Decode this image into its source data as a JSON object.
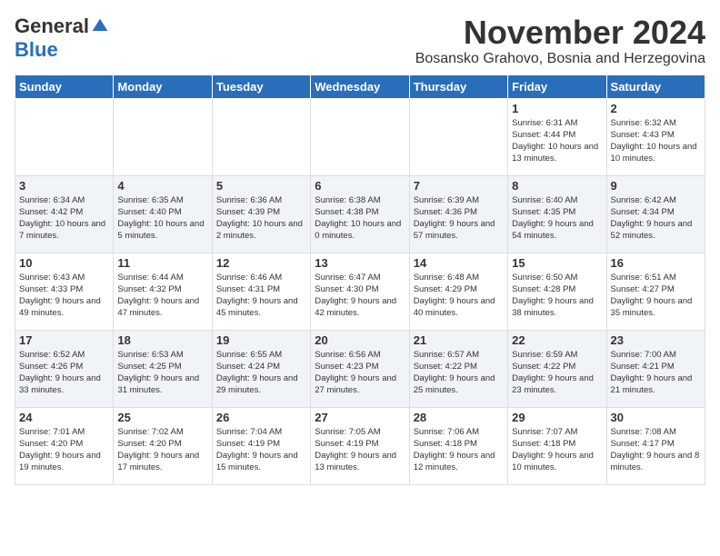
{
  "logo": {
    "general": "General",
    "blue": "Blue"
  },
  "title": "November 2024",
  "subtitle": "Bosansko Grahovo, Bosnia and Herzegovina",
  "weekdays": [
    "Sunday",
    "Monday",
    "Tuesday",
    "Wednesday",
    "Thursday",
    "Friday",
    "Saturday"
  ],
  "weeks": [
    [
      {
        "day": "",
        "info": ""
      },
      {
        "day": "",
        "info": ""
      },
      {
        "day": "",
        "info": ""
      },
      {
        "day": "",
        "info": ""
      },
      {
        "day": "",
        "info": ""
      },
      {
        "day": "1",
        "info": "Sunrise: 6:31 AM\nSunset: 4:44 PM\nDaylight: 10 hours and 13 minutes."
      },
      {
        "day": "2",
        "info": "Sunrise: 6:32 AM\nSunset: 4:43 PM\nDaylight: 10 hours and 10 minutes."
      }
    ],
    [
      {
        "day": "3",
        "info": "Sunrise: 6:34 AM\nSunset: 4:42 PM\nDaylight: 10 hours and 7 minutes."
      },
      {
        "day": "4",
        "info": "Sunrise: 6:35 AM\nSunset: 4:40 PM\nDaylight: 10 hours and 5 minutes."
      },
      {
        "day": "5",
        "info": "Sunrise: 6:36 AM\nSunset: 4:39 PM\nDaylight: 10 hours and 2 minutes."
      },
      {
        "day": "6",
        "info": "Sunrise: 6:38 AM\nSunset: 4:38 PM\nDaylight: 10 hours and 0 minutes."
      },
      {
        "day": "7",
        "info": "Sunrise: 6:39 AM\nSunset: 4:36 PM\nDaylight: 9 hours and 57 minutes."
      },
      {
        "day": "8",
        "info": "Sunrise: 6:40 AM\nSunset: 4:35 PM\nDaylight: 9 hours and 54 minutes."
      },
      {
        "day": "9",
        "info": "Sunrise: 6:42 AM\nSunset: 4:34 PM\nDaylight: 9 hours and 52 minutes."
      }
    ],
    [
      {
        "day": "10",
        "info": "Sunrise: 6:43 AM\nSunset: 4:33 PM\nDaylight: 9 hours and 49 minutes."
      },
      {
        "day": "11",
        "info": "Sunrise: 6:44 AM\nSunset: 4:32 PM\nDaylight: 9 hours and 47 minutes."
      },
      {
        "day": "12",
        "info": "Sunrise: 6:46 AM\nSunset: 4:31 PM\nDaylight: 9 hours and 45 minutes."
      },
      {
        "day": "13",
        "info": "Sunrise: 6:47 AM\nSunset: 4:30 PM\nDaylight: 9 hours and 42 minutes."
      },
      {
        "day": "14",
        "info": "Sunrise: 6:48 AM\nSunset: 4:29 PM\nDaylight: 9 hours and 40 minutes."
      },
      {
        "day": "15",
        "info": "Sunrise: 6:50 AM\nSunset: 4:28 PM\nDaylight: 9 hours and 38 minutes."
      },
      {
        "day": "16",
        "info": "Sunrise: 6:51 AM\nSunset: 4:27 PM\nDaylight: 9 hours and 35 minutes."
      }
    ],
    [
      {
        "day": "17",
        "info": "Sunrise: 6:52 AM\nSunset: 4:26 PM\nDaylight: 9 hours and 33 minutes."
      },
      {
        "day": "18",
        "info": "Sunrise: 6:53 AM\nSunset: 4:25 PM\nDaylight: 9 hours and 31 minutes."
      },
      {
        "day": "19",
        "info": "Sunrise: 6:55 AM\nSunset: 4:24 PM\nDaylight: 9 hours and 29 minutes."
      },
      {
        "day": "20",
        "info": "Sunrise: 6:56 AM\nSunset: 4:23 PM\nDaylight: 9 hours and 27 minutes."
      },
      {
        "day": "21",
        "info": "Sunrise: 6:57 AM\nSunset: 4:22 PM\nDaylight: 9 hours and 25 minutes."
      },
      {
        "day": "22",
        "info": "Sunrise: 6:59 AM\nSunset: 4:22 PM\nDaylight: 9 hours and 23 minutes."
      },
      {
        "day": "23",
        "info": "Sunrise: 7:00 AM\nSunset: 4:21 PM\nDaylight: 9 hours and 21 minutes."
      }
    ],
    [
      {
        "day": "24",
        "info": "Sunrise: 7:01 AM\nSunset: 4:20 PM\nDaylight: 9 hours and 19 minutes."
      },
      {
        "day": "25",
        "info": "Sunrise: 7:02 AM\nSunset: 4:20 PM\nDaylight: 9 hours and 17 minutes."
      },
      {
        "day": "26",
        "info": "Sunrise: 7:04 AM\nSunset: 4:19 PM\nDaylight: 9 hours and 15 minutes."
      },
      {
        "day": "27",
        "info": "Sunrise: 7:05 AM\nSunset: 4:19 PM\nDaylight: 9 hours and 13 minutes."
      },
      {
        "day": "28",
        "info": "Sunrise: 7:06 AM\nSunset: 4:18 PM\nDaylight: 9 hours and 12 minutes."
      },
      {
        "day": "29",
        "info": "Sunrise: 7:07 AM\nSunset: 4:18 PM\nDaylight: 9 hours and 10 minutes."
      },
      {
        "day": "30",
        "info": "Sunrise: 7:08 AM\nSunset: 4:17 PM\nDaylight: 9 hours and 8 minutes."
      }
    ]
  ]
}
